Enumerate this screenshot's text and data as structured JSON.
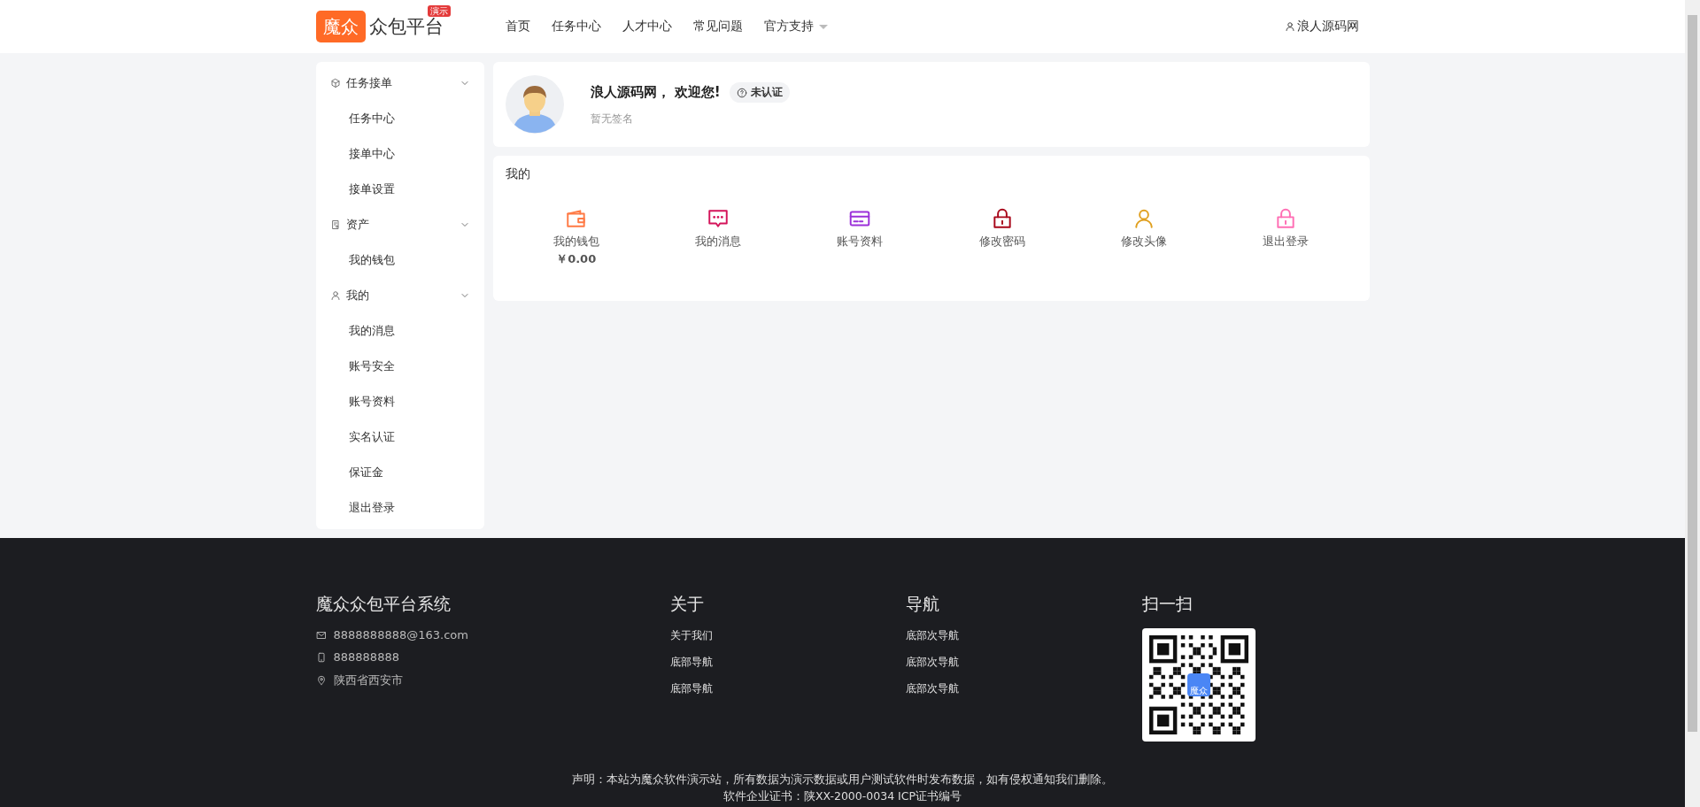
{
  "header": {
    "logo_mark": "魔众",
    "logo_text": "众包平台",
    "logo_badge": "演示",
    "nav": [
      {
        "label": "首页",
        "dropdown": false
      },
      {
        "label": "任务中心",
        "dropdown": false
      },
      {
        "label": "人才中心",
        "dropdown": false
      },
      {
        "label": "常见问题",
        "dropdown": false
      },
      {
        "label": "官方支持",
        "dropdown": true
      }
    ],
    "user": "浪人源码网"
  },
  "sidebar": {
    "groups": [
      {
        "label": "任务接单",
        "kind": "cube",
        "expanded": true,
        "children": [
          {
            "label": "任务中心"
          },
          {
            "label": "接单中心"
          },
          {
            "label": "接单设置"
          }
        ]
      },
      {
        "label": "资产",
        "kind": "ledger",
        "expanded": true,
        "children": [
          {
            "label": "我的钱包"
          }
        ]
      },
      {
        "label": "我的",
        "kind": "user",
        "expanded": true,
        "children": [
          {
            "label": "我的消息"
          },
          {
            "label": "账号安全"
          },
          {
            "label": "账号资料"
          },
          {
            "label": "实名认证"
          },
          {
            "label": "保证金"
          },
          {
            "label": "退出登录"
          }
        ]
      }
    ]
  },
  "profile": {
    "name": "浪人源码网， 欢迎您!",
    "status": "未认证",
    "signature": "暂无签名"
  },
  "my_panel": {
    "title": "我的",
    "items": [
      {
        "kind": "wallet",
        "color": "#ff7a45",
        "label": "我的钱包",
        "value": "￥0.00"
      },
      {
        "kind": "message",
        "color": "#d4145a",
        "label": "我的消息"
      },
      {
        "kind": "card",
        "color": "#9b30d9",
        "label": "账号资料"
      },
      {
        "kind": "lock",
        "color": "#a8071a",
        "label": "修改密码"
      },
      {
        "kind": "user",
        "color": "#e0a020",
        "label": "修改头像"
      },
      {
        "kind": "lock",
        "color": "#ff6eb4",
        "label": "退出登录"
      }
    ]
  },
  "footer": {
    "brand": "魔众众包平台系统",
    "contacts": [
      {
        "kind": "mail",
        "text": "8888888888@163.com"
      },
      {
        "kind": "phone",
        "text": "888888888"
      },
      {
        "kind": "pin",
        "text": "陕西省西安市"
      }
    ],
    "columns": [
      {
        "title": "关于",
        "links": [
          "关于我们",
          "底部导航",
          "底部导航"
        ]
      },
      {
        "title": "导航",
        "links": [
          "底部次导航",
          "底部次导航",
          "底部次导航"
        ]
      }
    ],
    "qr_title": "扫一扫",
    "qr_logo": "魔众",
    "notice": "声明：本站为魔众软件演示站，所有数据为演示数据或用户测试软件时发布数据，如有侵权通知我们删除。",
    "license": "软件企业证书：陕XX-2000-0034 ICP证书编号"
  }
}
